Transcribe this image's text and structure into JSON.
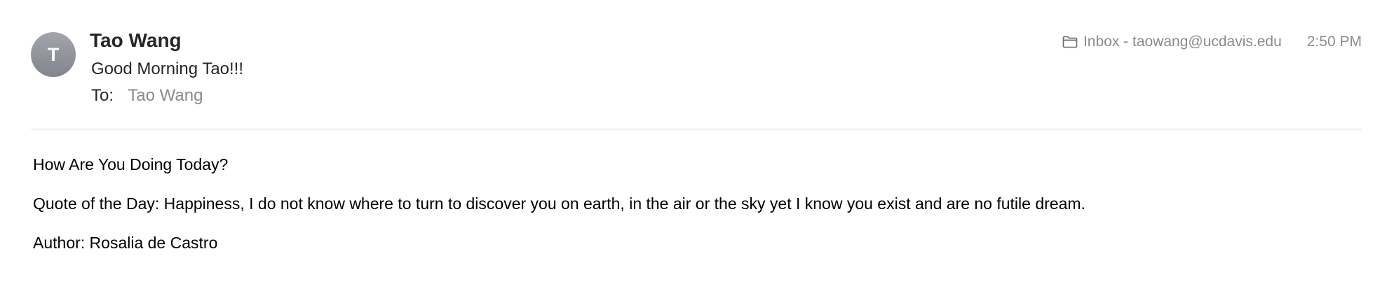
{
  "sender": {
    "avatar_initial": "T",
    "name": "Tao Wang"
  },
  "subject": "Good Morning Tao!!!",
  "recipients": {
    "label": "To:",
    "name": "Tao Wang"
  },
  "meta": {
    "mailbox": "Inbox - taowang@ucdavis.edu",
    "time": "2:50 PM",
    "icon": "folder-icon"
  },
  "body": {
    "greeting": "How Are You Doing Today?",
    "quote": "Quote of the Day: Happiness, I do not know where to turn to discover you on earth, in the air or the sky yet I know you exist and are no futile dream.",
    "author": "Author: Rosalia de Castro"
  },
  "colors": {
    "avatar": "#8e9098",
    "secondary_text": "#8a8a8a",
    "divider": "#dcdcdc"
  }
}
